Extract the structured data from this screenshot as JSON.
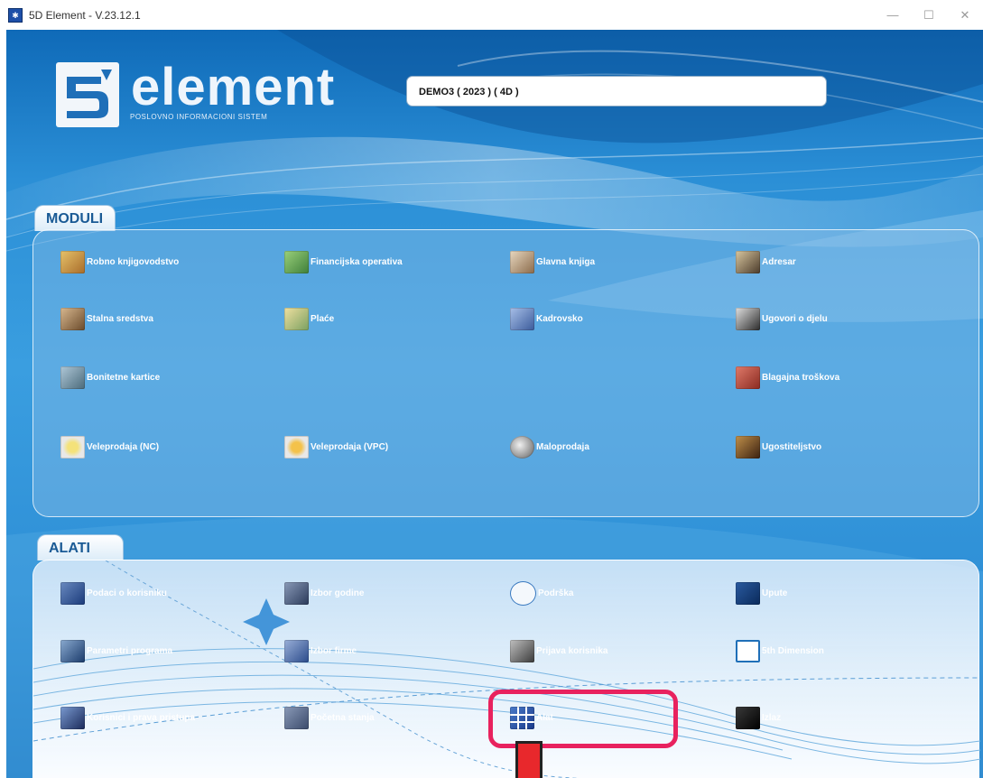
{
  "window": {
    "title": "5D Element - V.23.12.1",
    "controls": [
      "—",
      "☐",
      "✕"
    ]
  },
  "brand": {
    "word": "element",
    "tagline": "POSLOVNO INFORMACIONI SISTEM"
  },
  "company_field": {
    "value": "DEMO3 ( 2023 ) ( 4D )"
  },
  "moduli": {
    "tab_label": "MODULI",
    "items": [
      {
        "label": "Robno knjigovodstvo",
        "icon": "warehouse-icon"
      },
      {
        "label": "Financijska operativa",
        "icon": "chart-icon"
      },
      {
        "label": "Glavna knjiga",
        "icon": "book-icon"
      },
      {
        "label": "Adresar",
        "icon": "pen-icon"
      },
      {
        "label": "Stalna sredstva",
        "icon": "assets-icon"
      },
      {
        "label": "Plaće",
        "icon": "money-icon"
      },
      {
        "label": "Kadrovsko",
        "icon": "chair-icon"
      },
      {
        "label": "Ugovori o djelu",
        "icon": "contract-icon"
      },
      {
        "label": "Bonitetne kartice",
        "icon": "card-icon"
      },
      {
        "label": "Blagajna troškova",
        "icon": "cashbox-icon"
      },
      {
        "label": "Veleprodaja (NC)",
        "icon": "wholesale-icon"
      },
      {
        "label": "Veleprodaja (VPC)",
        "icon": "wholesale-icon"
      },
      {
        "label": "Maloprodaja",
        "icon": "retail-icon"
      },
      {
        "label": "Ugostiteljstvo",
        "icon": "catering-icon"
      }
    ]
  },
  "alati": {
    "tab_label": "ALATI",
    "items": [
      {
        "label": "Podaci o korisniku",
        "icon": "user-data-icon"
      },
      {
        "label": "Izbor godine",
        "icon": "calendar-icon"
      },
      {
        "label": "Podrška",
        "icon": "headset-icon"
      },
      {
        "label": "Upute",
        "icon": "help-icon"
      },
      {
        "label": "Parametri programa",
        "icon": "settings-icon"
      },
      {
        "label": "Izbor firme",
        "icon": "company-icon"
      },
      {
        "label": "Prijava korisnika",
        "icon": "login-icon"
      },
      {
        "label": "5th Dimension",
        "icon": "fifth-dimension-icon"
      },
      {
        "label": "Korisnici i prava pristupa",
        "icon": "users-icon"
      },
      {
        "label": "Početna stanja",
        "icon": "initial-state-icon"
      },
      {
        "label": "Alat",
        "icon": "grid-tool-icon"
      },
      {
        "label": "Izlaz",
        "icon": "exit-icon"
      }
    ]
  },
  "colors": {
    "accent": "#1d7ac5",
    "highlight": "#e8225e",
    "marker": "#e8282c"
  }
}
